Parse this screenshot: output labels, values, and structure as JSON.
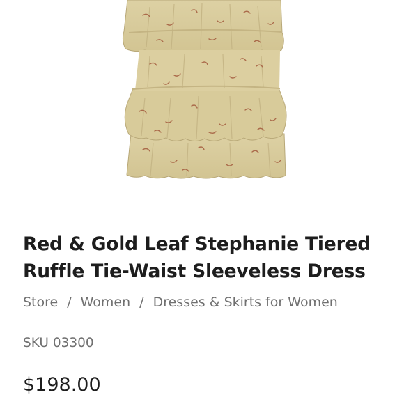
{
  "product": {
    "title": "Red & Gold Leaf Stephanie Tiered Ruffle Tie-Waist Sleeveless Dress",
    "sku_label": "SKU",
    "sku_value": "03300",
    "price": "$198.00",
    "image_icon": "tiered-ruffle-skirt-image"
  },
  "breadcrumb": {
    "items": [
      "Store",
      "Women",
      "Dresses & Skirts for Women"
    ],
    "separator": "/"
  },
  "colors": {
    "fabric": "#d9cc9c",
    "fabric_shadow": "#b8a878",
    "print_red": "#a35a3d",
    "text_dark": "#1d1d1d",
    "text_muted": "#707070"
  }
}
